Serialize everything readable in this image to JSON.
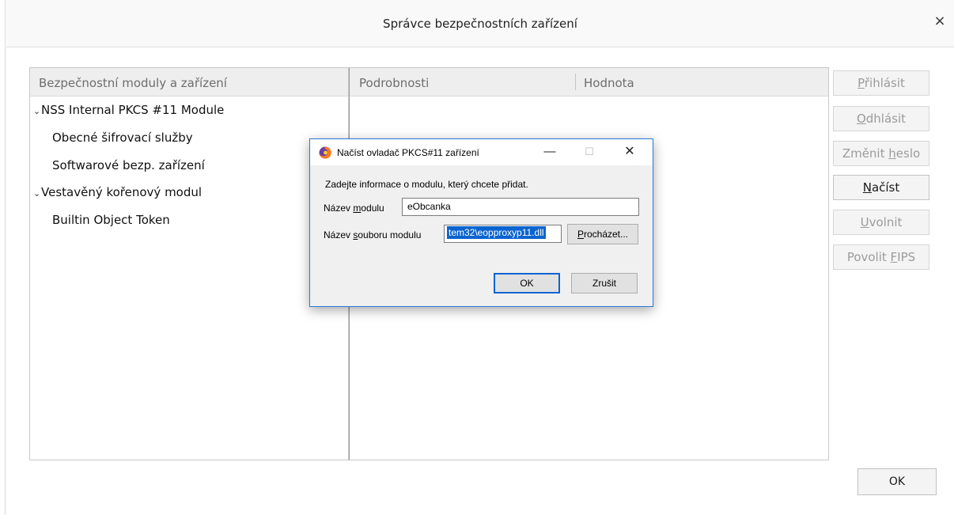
{
  "window": {
    "title": "Správce bezpečnostních zařízení",
    "close_glyph": "×"
  },
  "tree": {
    "header": "Bezpečnostní moduly a zařízení",
    "items": [
      {
        "label": "NSS Internal PKCS #11 Module",
        "expanded": true,
        "level": 0
      },
      {
        "label": "Obecné šifrovací služby",
        "level": 1
      },
      {
        "label": "Softwarové bezp. zařízení",
        "level": 1
      },
      {
        "label": "Vestavěný kořenový modul",
        "expanded": true,
        "level": 0
      },
      {
        "label": "Builtin Object Token",
        "level": 1
      }
    ],
    "expand_glyph": "⌄"
  },
  "details": {
    "col_details": "Podrobnosti",
    "col_value": "Hodnota"
  },
  "side_buttons": {
    "login": {
      "pre": "",
      "accel": "P",
      "post": "řihlásit",
      "enabled": false
    },
    "logout": {
      "pre": "",
      "accel": "O",
      "post": "dhlásit",
      "enabled": false
    },
    "change_password": {
      "pre": "Změnit ",
      "accel": "h",
      "post": "eslo",
      "enabled": false
    },
    "load": {
      "pre": "",
      "accel": "N",
      "post": "ačíst",
      "enabled": true
    },
    "unload": {
      "pre": "",
      "accel": "U",
      "post": "volnit",
      "enabled": false
    },
    "enable_fips": {
      "pre": "Povolit ",
      "accel": "F",
      "post": "IPS",
      "enabled": false
    }
  },
  "ok_label": "OK",
  "dialog": {
    "title": "Načíst ovladač PKCS#11 zařízení",
    "min_glyph": "—",
    "max_glyph": "☐",
    "close_glyph": "✕",
    "prompt": "Zadejte informace o modulu, který chcete přidat.",
    "module_name_label_pre": "Název ",
    "module_name_label_accel": "m",
    "module_name_label_post": "odulu",
    "module_name_value": "eObcanka",
    "module_file_label_pre": "Název ",
    "module_file_label_accel": "s",
    "module_file_label_post": "ouboru modulu",
    "module_file_value": "tem32\\eopproxyp11.dll",
    "browse_accel": "P",
    "browse_post": "rocházet...",
    "ok_label": "OK",
    "cancel_label": "Zrušit",
    "brand_colors": {
      "fox_orange": "#ff7a18",
      "globe_purple": "#6b3fa0"
    }
  }
}
